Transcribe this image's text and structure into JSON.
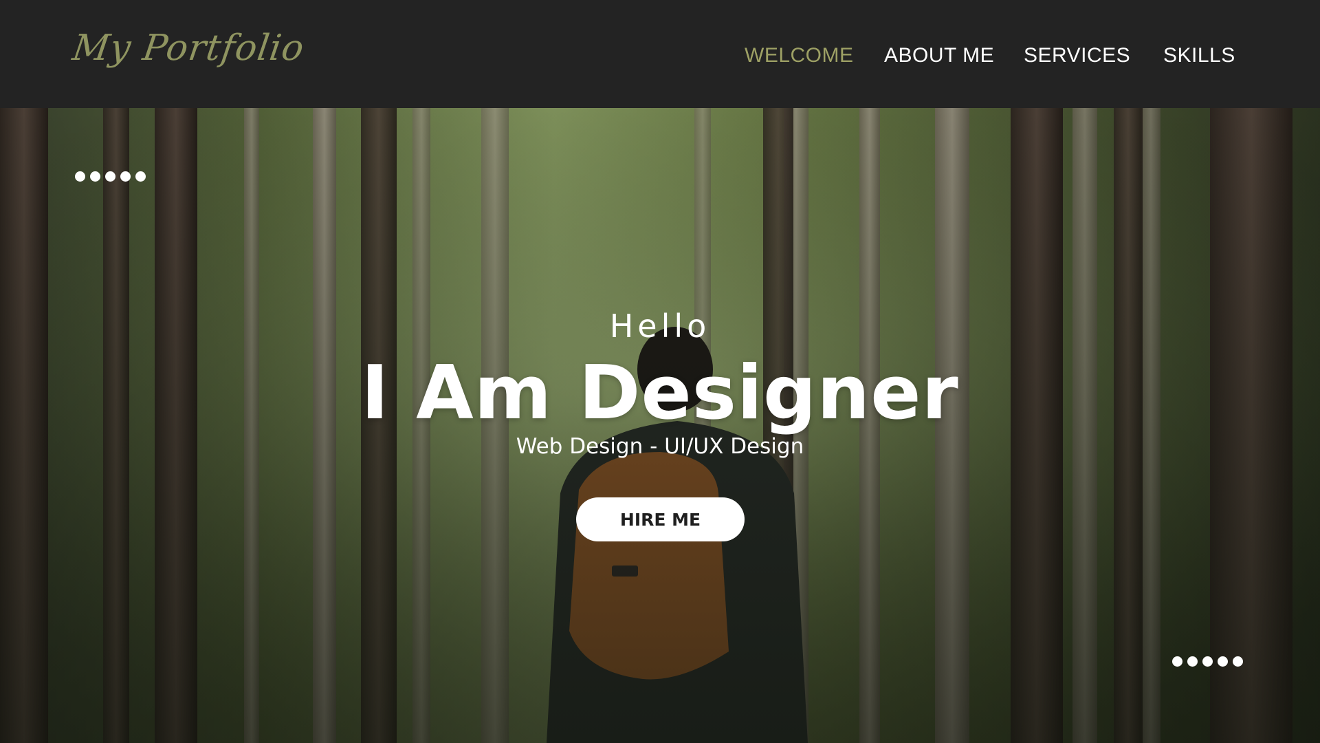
{
  "header": {
    "logo_text": "My Portfolio",
    "nav": [
      {
        "label": "WELCOME",
        "active": true
      },
      {
        "label": "ABOUT ME",
        "active": false
      },
      {
        "label": "SERVICES",
        "active": false
      },
      {
        "label": "SKILLS",
        "active": false
      }
    ]
  },
  "hero": {
    "greeting": "Hello",
    "headline": "I Am Designer",
    "subtitle": "Web Design - UI/UX Design",
    "cta_label": "HIRE ME",
    "background_image": "forest-hiker-photo"
  },
  "colors": {
    "header_bg": "#232323",
    "accent": "#9ea165",
    "text": "#ffffff",
    "button_bg": "#ffffff",
    "button_text": "#1f1f1f"
  }
}
